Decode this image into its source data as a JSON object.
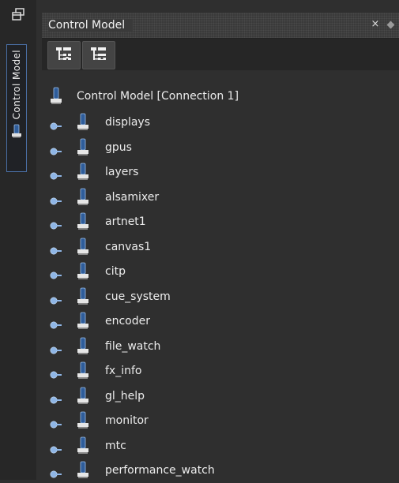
{
  "dock": {
    "side_tab_label": "Control Model"
  },
  "panel": {
    "title": "Control Model",
    "close_glyph": "×"
  },
  "toolbar": {
    "buttons": [
      {
        "icon": "expand-tree-icon"
      },
      {
        "icon": "collapse-tree-icon"
      }
    ]
  },
  "tree": {
    "root": {
      "label": "Control Model [Connection 1]",
      "icon": "node-icon"
    },
    "children": [
      {
        "label": "displays"
      },
      {
        "label": "gpus"
      },
      {
        "label": "layers"
      },
      {
        "label": "alsamixer"
      },
      {
        "label": "artnet1"
      },
      {
        "label": "canvas1"
      },
      {
        "label": "citp"
      },
      {
        "label": "cue_system"
      },
      {
        "label": "encoder"
      },
      {
        "label": "file_watch"
      },
      {
        "label": "fx_info"
      },
      {
        "label": "gl_help"
      },
      {
        "label": "monitor"
      },
      {
        "label": "mtc"
      },
      {
        "label": "performance_watch"
      }
    ]
  },
  "colors": {
    "background": "#2f2f2f",
    "dock": "#272727",
    "tab_border": "#4a6fa5",
    "node_blue": "#2f5d9a",
    "text": "#ededed"
  }
}
